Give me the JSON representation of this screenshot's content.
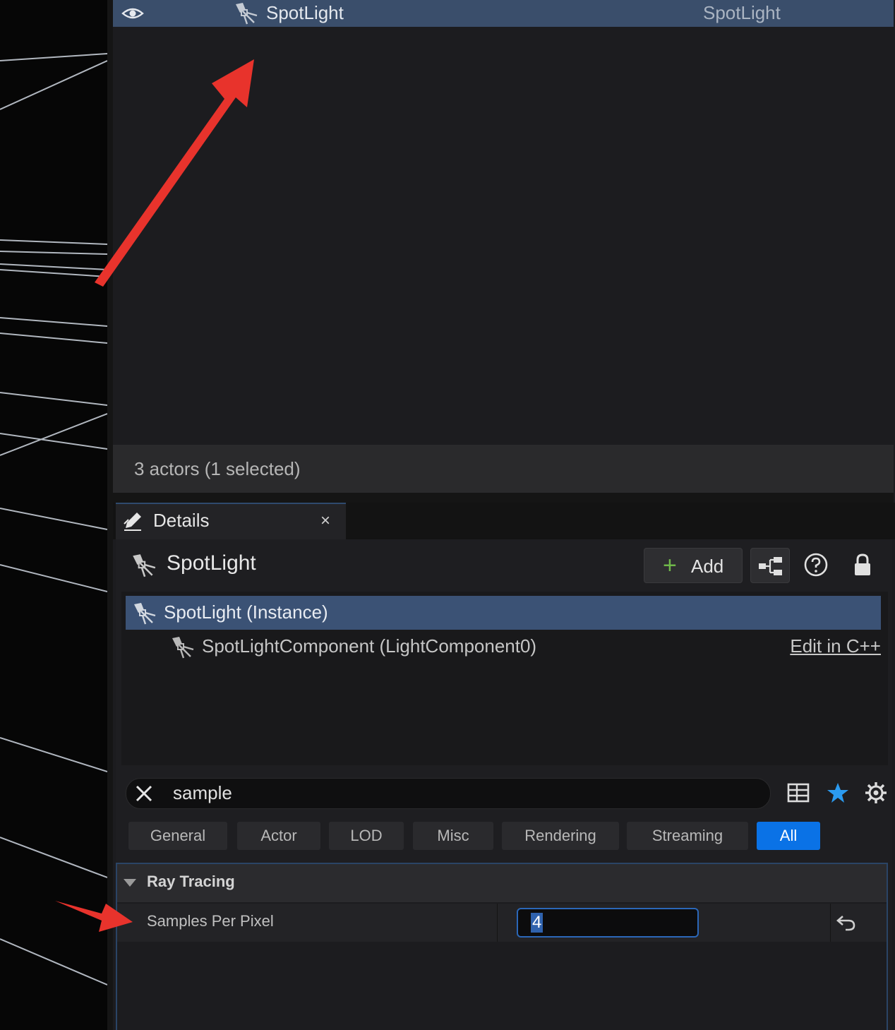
{
  "outliner": {
    "selected_row": {
      "name": "SpotLight",
      "type": "SpotLight"
    },
    "status": "3 actors (1 selected)"
  },
  "details_tab": {
    "label": "Details",
    "close": "×"
  },
  "details": {
    "actor_name": "SpotLight",
    "add_label": "Add",
    "components": [
      {
        "label": "SpotLight (Instance)"
      },
      {
        "label": "SpotLightComponent (LightComponent0)",
        "link": "Edit in C++"
      }
    ],
    "search": {
      "value": "sample"
    },
    "filters": [
      {
        "label": "General"
      },
      {
        "label": "Actor"
      },
      {
        "label": "LOD"
      },
      {
        "label": "Misc"
      },
      {
        "label": "Rendering"
      },
      {
        "label": "Streaming"
      },
      {
        "label": "All",
        "active": true
      }
    ],
    "section": {
      "title": "Ray Tracing",
      "property": {
        "name": "Samples Per Pixel",
        "value": "4"
      }
    }
  },
  "colors": {
    "selection": "#3a4e6b",
    "accent_blue": "#0a72e6",
    "annotation_arrow": "#e8332c",
    "add_plus": "#6fb84a",
    "star": "#2b9bf0"
  }
}
